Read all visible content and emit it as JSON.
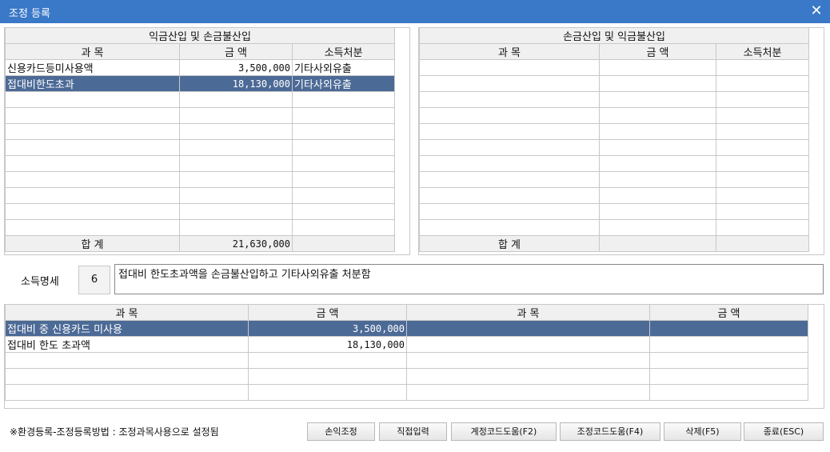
{
  "window": {
    "title": "조정 등록",
    "close_icon": "close-icon"
  },
  "left_grid": {
    "caption": "익금산입 및 손금불산입",
    "headers": [
      "과  목",
      "금  액",
      "소득처분"
    ],
    "rows": [
      {
        "subject": "신용카드등미사용액",
        "amount": "3,500,000",
        "disposal": "기타사외유출"
      },
      {
        "subject": "접대비한도초과",
        "amount": "18,130,000",
        "disposal": "기타사외유출"
      }
    ],
    "total_label": "합     계",
    "total_amount": "21,630,000"
  },
  "right_grid": {
    "caption": "손금산입 및 익금불산입",
    "headers": [
      "과  목",
      "금  액",
      "소득처분"
    ],
    "rows": [],
    "total_label": "합     계",
    "total_amount": ""
  },
  "income_detail": {
    "label": "소득명세",
    "code": "6",
    "text": "접대비 한도초과액을 손금불산입하고 기타사외유출 처분함"
  },
  "bottom_grid": {
    "headers": [
      "과  목",
      "금  액",
      "과  목",
      "금  액"
    ],
    "rows": [
      {
        "subject1": "접대비 중 신용카드 미사용",
        "amount1": "3,500,000",
        "subject2": "",
        "amount2": ""
      },
      {
        "subject1": "접대비 한도 초과액",
        "amount1": "18,130,000",
        "subject2": "",
        "amount2": ""
      }
    ]
  },
  "footer": {
    "note": "※환경등록-조정등록방법 : 조정과목사용으로 설정됨",
    "buttons": {
      "profit_adjust": "손익조정",
      "direct_input": "직접입력",
      "account_code_help": "계정코드도움(F2)",
      "adjust_code_help": "조정코드도움(F4)",
      "delete": "삭제(F5)",
      "exit": "종료(ESC)"
    }
  },
  "colors": {
    "titlebar": "#3a78c8",
    "selected_row": "#4c6a96",
    "header_bg": "#f0f0f0"
  }
}
